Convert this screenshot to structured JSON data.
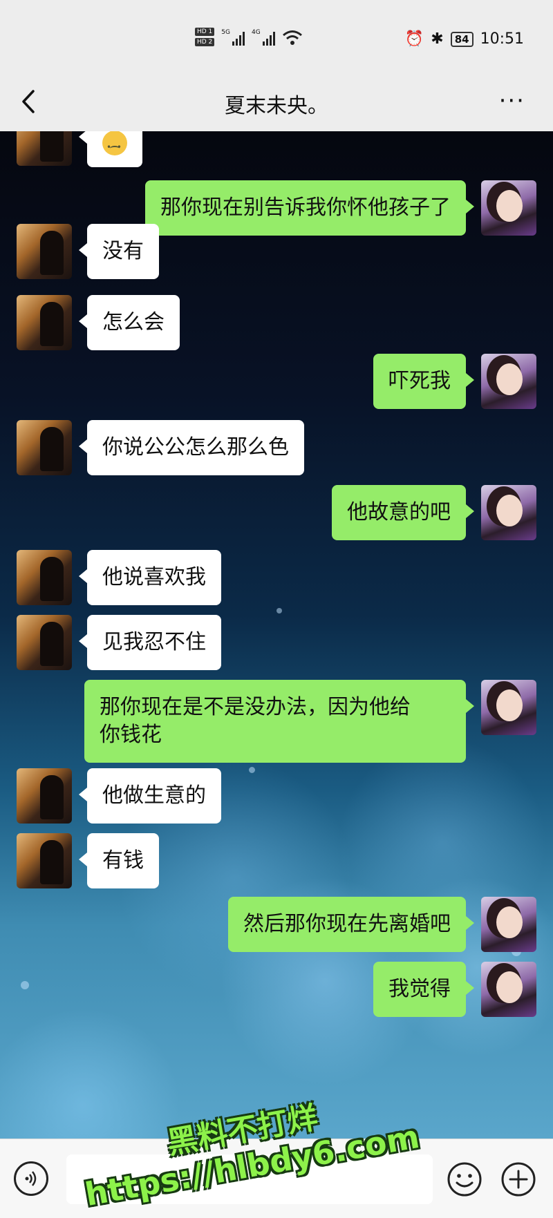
{
  "status_bar": {
    "hd1": "HD 1",
    "hd2": "HD 2",
    "net1": "5G",
    "net2": "4G",
    "battery": "84",
    "time": "10:51"
  },
  "header": {
    "title": "夏末未央。",
    "more": "···"
  },
  "messages": [
    {
      "side": "left",
      "text": "🙂"
    },
    {
      "side": "right",
      "text": "那你现在别告诉我你怀他孩子了"
    },
    {
      "side": "left",
      "text": "没有"
    },
    {
      "side": "left",
      "text": "怎么会"
    },
    {
      "side": "right",
      "text": "吓死我"
    },
    {
      "side": "left",
      "text": "你说公公怎么那么色"
    },
    {
      "side": "right",
      "text": "他故意的吧"
    },
    {
      "side": "left",
      "text": "他说喜欢我"
    },
    {
      "side": "left",
      "text": "见我忍不住"
    },
    {
      "side": "right",
      "line1": "那你现在是不是没办法，因为他给",
      "line2": "你钱花"
    },
    {
      "side": "left",
      "text": "他做生意的"
    },
    {
      "side": "left",
      "text": "有钱"
    },
    {
      "side": "right",
      "text": "然后那你现在先离婚吧"
    },
    {
      "side": "right",
      "text": "我觉得"
    }
  ],
  "watermark": {
    "line1": "黑料不打烊",
    "line2": "https://hlbdy6.com"
  },
  "input_bar": {
    "placeholder": ""
  },
  "colors": {
    "bubble_right": "#95ec69",
    "bubble_left": "#ffffff",
    "watermark": "#8df24a"
  }
}
